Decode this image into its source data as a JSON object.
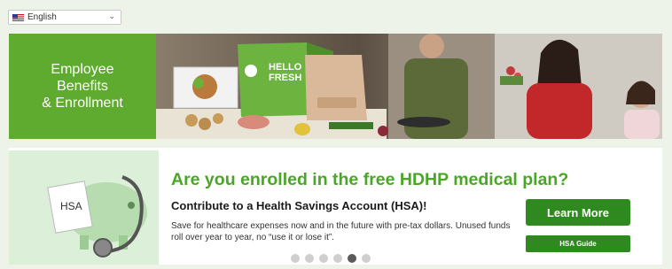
{
  "language_select": {
    "value": "English",
    "flag": "us-flag-icon"
  },
  "banner": {
    "title": "Employee\nBenefits\n& Enrollment",
    "box_label_1": "HELLO",
    "box_label_2": "FRESH",
    "accent_color": "#5fab2f"
  },
  "promo": {
    "hsa_tag": "HSA",
    "headline": "Are you enrolled in the free HDHP medical plan?",
    "subhead": "Contribute to a Health Savings Account (HSA)!",
    "body": "Save for healthcare expenses now and in the future with pre-tax dollars. Unused funds roll over year to year, no “use it or lose it”.",
    "learn_more_label": "Learn More",
    "guide_label": "HSA Guide",
    "button_color": "#2e8a1f",
    "headline_color": "#4aa626"
  },
  "carousel": {
    "total_slides": 6,
    "active_slide": 5
  }
}
